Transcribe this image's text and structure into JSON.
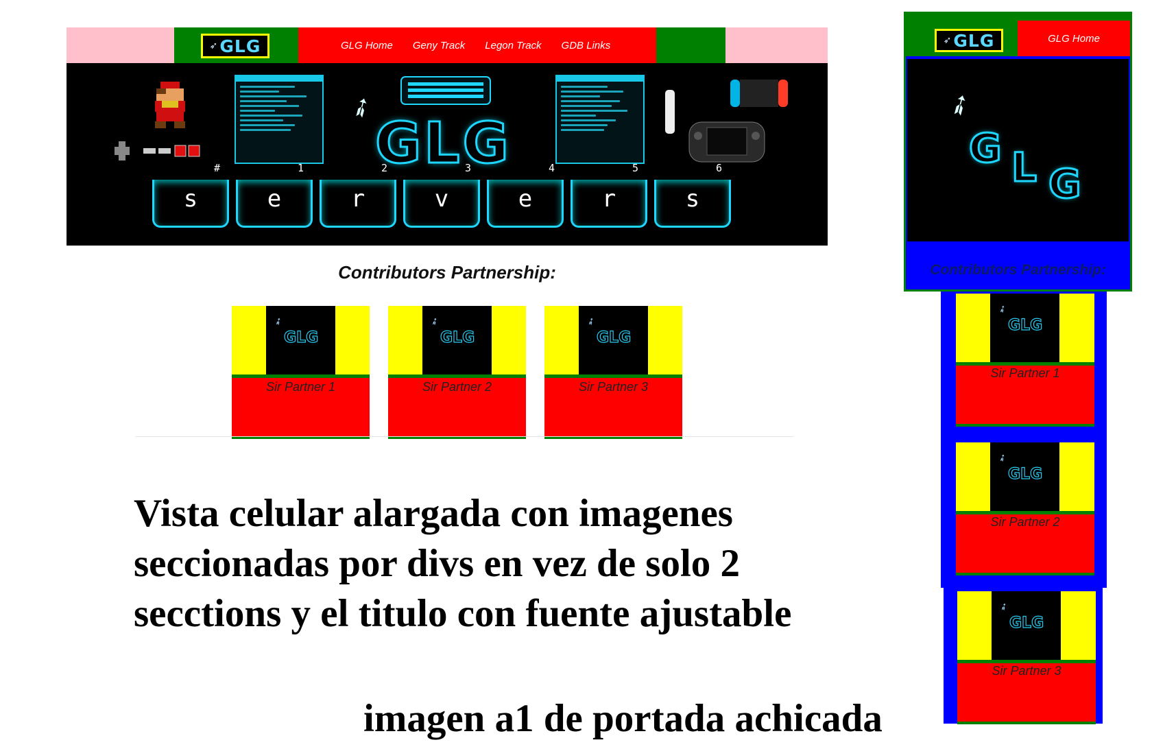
{
  "desktop": {
    "logo_text": "GLG",
    "nav": [
      "GLG Home",
      "Geny Track",
      "Legon Track",
      "GDB Links"
    ],
    "banner": {
      "title": "GLG",
      "keys": [
        {
          "letter": "s",
          "num": "#"
        },
        {
          "letter": "e",
          "num": "1"
        },
        {
          "letter": "r",
          "num": "2"
        },
        {
          "letter": "v",
          "num": "3"
        },
        {
          "letter": "e",
          "num": "4"
        },
        {
          "letter": "r",
          "num": "5"
        },
        {
          "letter": "s",
          "num": "6"
        }
      ]
    },
    "contrib_title": "Contributors Partnership:",
    "partners": [
      "Sir Partner 1",
      "Sir Partner 2",
      "Sir Partner 3"
    ]
  },
  "mobile": {
    "logo_text": "GLG",
    "nav_home": "GLG Home",
    "hero_title": [
      "G",
      "L",
      "G"
    ],
    "contrib_title": "Contributors Partnership:",
    "partners": [
      "Sir Partner 1",
      "Sir Partner 2",
      "Sir Partner 3"
    ]
  },
  "card_logo": "GLG",
  "notes": {
    "main": "Vista celular alargada con imagenes seccionadas por divs en vez de solo 2 secctions y el titulo con fuente ajustable",
    "secondary": "imagen a1 de portada achicada"
  }
}
